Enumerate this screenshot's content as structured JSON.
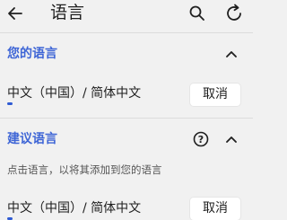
{
  "header": {
    "title": "语言"
  },
  "your_languages": {
    "section_title": "您的语言",
    "items": [
      {
        "label": "中文（中国）/ 简体中文",
        "action": "取消"
      }
    ]
  },
  "suggested_languages": {
    "section_title": "建议语言",
    "hint": "点击语言，以将其添加到您的语言",
    "items": [
      {
        "label": "中文（中国）/ 简体中文",
        "action": "取消"
      }
    ]
  },
  "colors": {
    "accent": "#3f66d6",
    "background": "#f1f1f1",
    "button_bg": "#ffffff"
  },
  "icons": [
    "back-arrow-icon",
    "search-icon",
    "refresh-icon",
    "chevron-up-icon",
    "help-icon"
  ]
}
